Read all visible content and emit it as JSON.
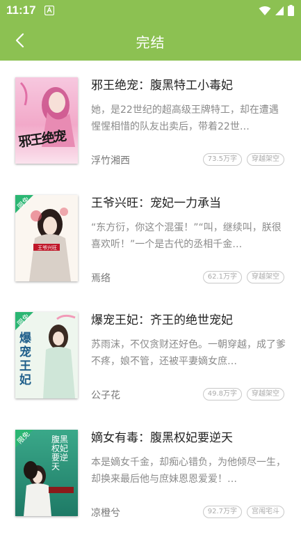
{
  "status": {
    "time": "11:17"
  },
  "header": {
    "title": "完结",
    "back_icon": "chevron-left-icon"
  },
  "colors": {
    "accent": "#8cc152",
    "limited_badge": "#2bb673"
  },
  "books": [
    {
      "title": "邪王绝宠：腹黑特工小毒妃",
      "desc": "她，是22世纪的超高级王牌特工，却在遭遇惺惺相惜的队友出卖后，带着22世…",
      "author": "浮竹湘西",
      "words": "73.5万字",
      "genre": "穿越架空",
      "cover_text": "邪王绝宠",
      "limited": false
    },
    {
      "title": "王爷兴旺：宠妃一力承当",
      "desc": "“东方衍，你这个混蛋！”“叫，继续叫，朕很喜欢听！”一个是古代的丞相千金…",
      "author": "焉络",
      "words": "62.1万字",
      "genre": "穿越架空",
      "cover_text": "王爷兴旺",
      "limited": true,
      "limited_label": "限免"
    },
    {
      "title": "爆宠王妃：齐王的绝世宠妃",
      "desc": "苏雨沫，不仅贪财还好色。一朝穿越，成了爹不疼，娘不管，还被平妻嫡女庶…",
      "author": "公子花",
      "words": "49.8万字",
      "genre": "穿越架空",
      "cover_text": "爆宠王妃",
      "limited": true,
      "limited_label": "限免"
    },
    {
      "title": "嫡女有毒：腹黑权妃要逆天",
      "desc": "本是嫡女千金，却痴心错负，为他倾尽一生，却换来最后他与庶妹恩恩爱爱！…",
      "author": "凉橙兮",
      "words": "92.7万字",
      "genre": "宫闱宅斗",
      "cover_text": "腹黑权妃要逆天",
      "limited": true,
      "limited_label": "限免"
    }
  ]
}
